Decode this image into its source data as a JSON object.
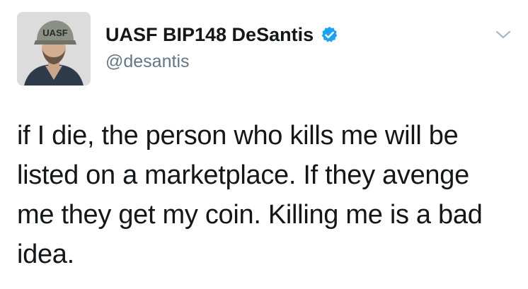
{
  "user": {
    "display_name": "UASF BIP148 DeSantis",
    "handle": "@desantis",
    "verified": true,
    "verified_icon": "verified-badge-icon",
    "avatar": {
      "cap_text": "UASF"
    }
  },
  "menu": {
    "icon": "chevron-down-icon"
  },
  "tweet": {
    "lines": [
      "if I die, the person who kills me will be",
      "listed on a marketplace. If they avenge",
      "me they get my coin. Killing me is a bad",
      "idea."
    ]
  },
  "colors": {
    "verified_blue": "#1da1f2",
    "handle_gray": "#657786",
    "text": "#14171a",
    "chevron": "#aab8c2"
  }
}
